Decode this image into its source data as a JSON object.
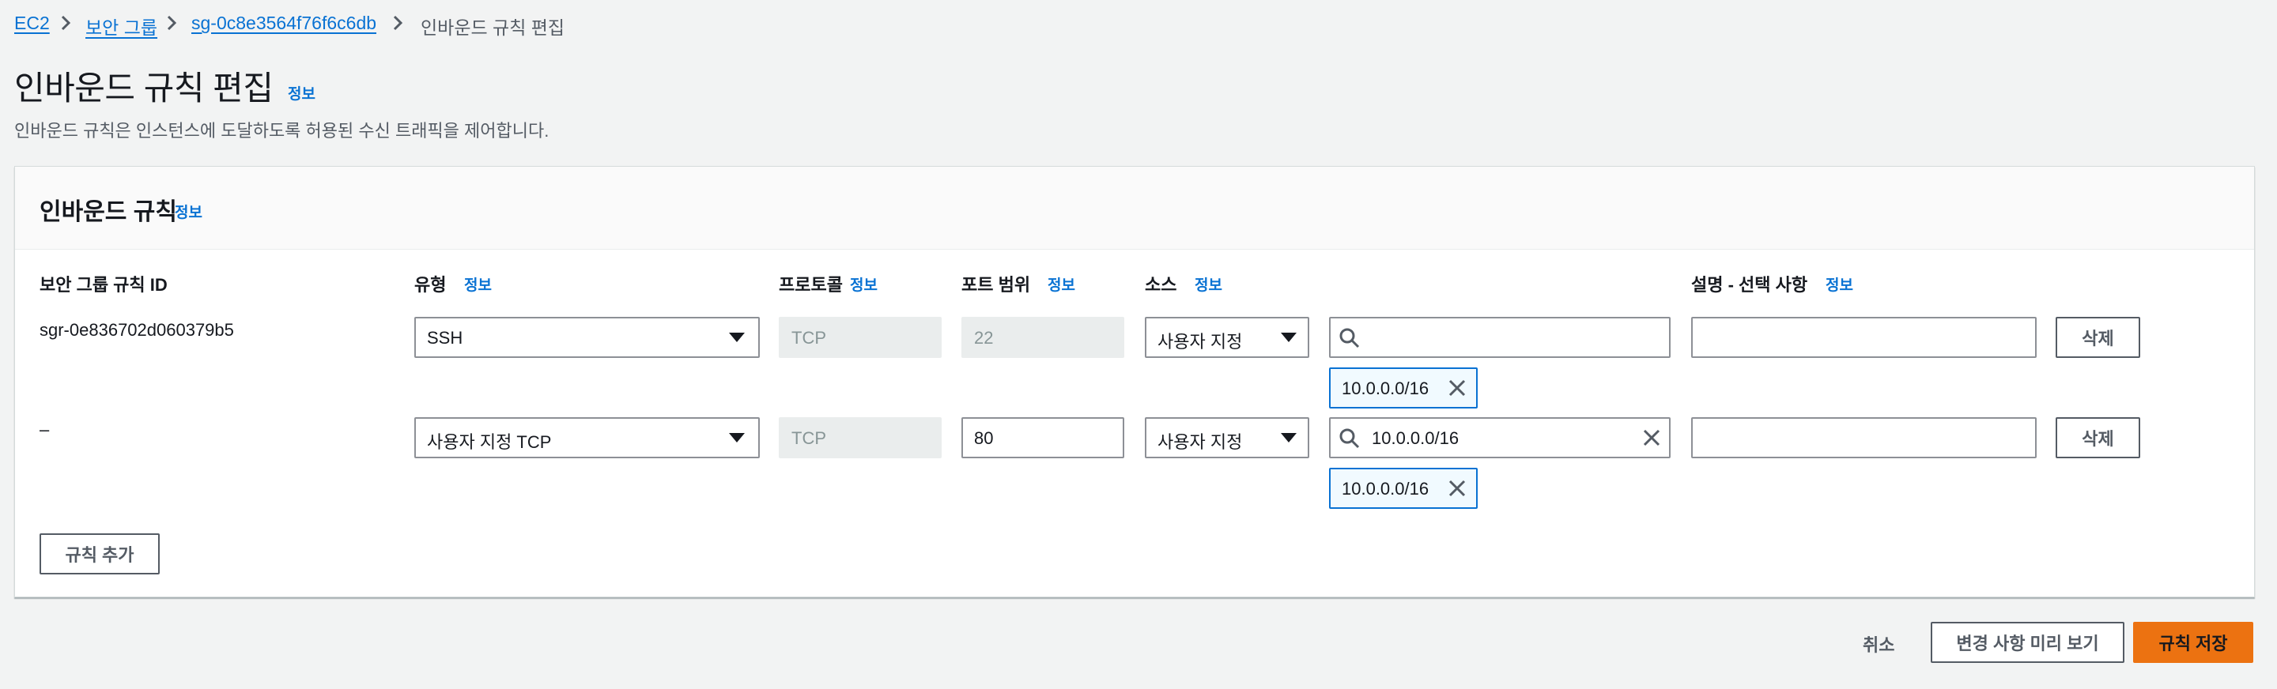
{
  "breadcrumb": {
    "items": [
      "EC2",
      "보안 그룹",
      "sg-0c8e3564f76f6c6db"
    ],
    "current": "인바운드 규칙 편집"
  },
  "page": {
    "title": "인바운드 규칙 편집",
    "info": "정보",
    "description": "인바운드 규칙은 인스턴스에 도달하도록 허용된 수신 트래픽을 제어합니다."
  },
  "panel": {
    "title": "인바운드 규칙",
    "info": "정보",
    "columns": {
      "rule_id": "보안 그룹 규칙 ID",
      "type": "유형",
      "type_info": "정보",
      "protocol": "프로토콜",
      "protocol_info": "정보",
      "port": "포트 범위",
      "port_info": "정보",
      "source": "소스",
      "source_info": "정보",
      "description": "설명 - 선택 사항",
      "description_info": "정보"
    },
    "rows": [
      {
        "rule_id": "sgr-0e836702d060379b5",
        "type": "SSH",
        "protocol": "TCP",
        "port": "22",
        "source_type": "사용자 지정",
        "search_value": "",
        "token": "10.0.0.0/16",
        "description": "",
        "delete": "삭제"
      },
      {
        "rule_id": "–",
        "type": "사용자 지정 TCP",
        "protocol": "TCP",
        "port": "80",
        "source_type": "사용자 지정",
        "search_value": "10.0.0.0/16",
        "token": "10.0.0.0/16",
        "description": "",
        "delete": "삭제"
      }
    ],
    "add_rule": "규칙 추가"
  },
  "footer": {
    "cancel": "취소",
    "preview": "변경 사항 미리 보기",
    "save": "규칙 저장"
  },
  "colors": {
    "link": "#0972d3",
    "primary": "#ec7211",
    "background": "#f2f3f3"
  }
}
